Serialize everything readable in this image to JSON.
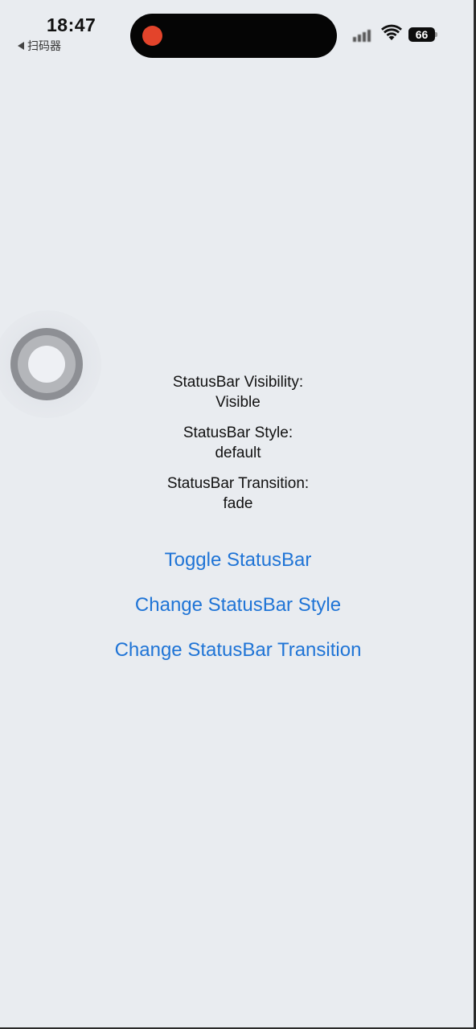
{
  "status_bar": {
    "time": "18:47",
    "back_app": "扫码器",
    "battery": "66"
  },
  "info": {
    "visibility_label": "StatusBar Visibility:",
    "visibility_value": "Visible",
    "style_label": "StatusBar Style:",
    "style_value": "default",
    "transition_label": "StatusBar Transition:",
    "transition_value": "fade"
  },
  "buttons": {
    "toggle": "Toggle StatusBar",
    "change_style": "Change StatusBar Style",
    "change_transition": "Change StatusBar Transition"
  },
  "colors": {
    "background": "#e9ecf0",
    "link": "#1f74d6",
    "record_dot": "#e3442b"
  },
  "icons": {
    "back": "back-arrow-icon",
    "signal": "cellular-signal-icon",
    "wifi": "wifi-icon",
    "battery": "battery-icon",
    "assistive": "assistive-touch-icon"
  }
}
